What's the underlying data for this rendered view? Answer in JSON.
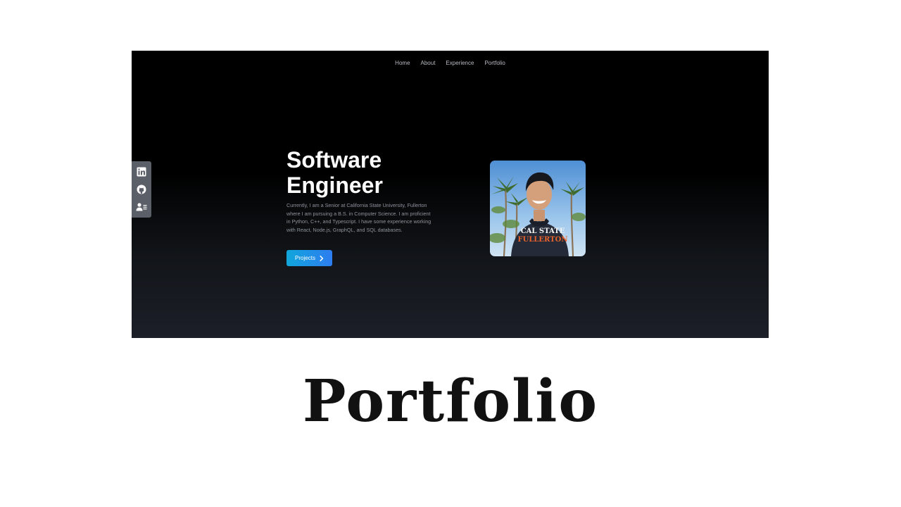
{
  "nav": {
    "items": [
      "Home",
      "About",
      "Experience",
      "Portfolio"
    ]
  },
  "social": {
    "icons": [
      "linkedin-icon",
      "github-icon",
      "resume-icon"
    ]
  },
  "hero": {
    "title_line1": "Software",
    "title_line2": "Engineer",
    "description": "Currently, I am a Senior at California State University, Fullerton where I am pursuing a B.S. in Computer Science. I am proficient in Python, C++, and Typescript. I have some experience working with React, Node.js, GraphQL, and SQL databases.",
    "button_label": "Projects",
    "button_icon": "chevron-right-icon",
    "photo_sweatshirt_text_line1": "CAL STATE",
    "photo_sweatshirt_text_line2": "FULLERTON"
  },
  "caption": "Portfolio",
  "colors": {
    "button_start": "#10a6dc",
    "button_end": "#2e7df0",
    "sidebar_bg": "#5b5f68"
  }
}
